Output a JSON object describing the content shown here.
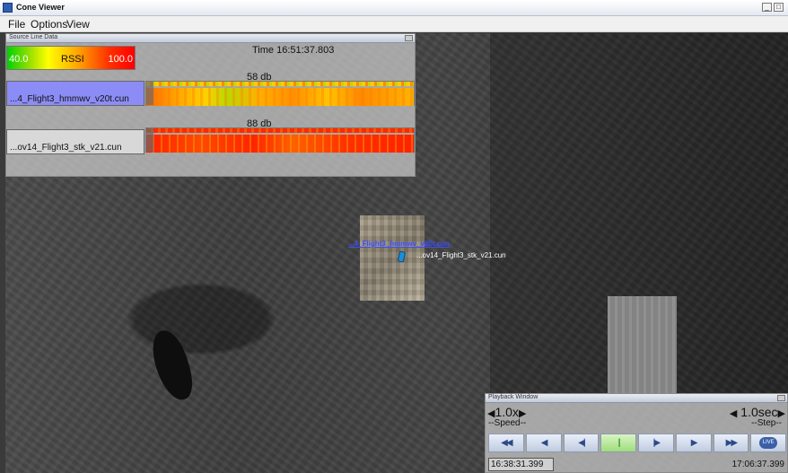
{
  "window": {
    "title": "Cone Viewer",
    "min": "_",
    "max": "□"
  },
  "menu": [
    "File",
    "Options",
    "View"
  ],
  "source_panel": {
    "title": "Source Line Data",
    "legend": {
      "min": "40.0",
      "label": "RSSI",
      "max": "100.0"
    },
    "time": "Time 16:51:37.803",
    "tracks": [
      {
        "name": "...4_Flight3_hmmwv_v20t.cun",
        "db": "58 db"
      },
      {
        "name": "...ov14_Flight3_stk_v21.cun",
        "db": "88 db"
      }
    ]
  },
  "map": {
    "labels": {
      "track1": "...4_Flight3_hmmwv_v20t.cun",
      "track2": "...ov14_Flight3_stk_v21.cun"
    }
  },
  "playback": {
    "title": "Playback Window",
    "speed": {
      "value": "1.0x",
      "label": "--Speed--"
    },
    "step": {
      "value": "1.0sec",
      "label": "--Step--"
    },
    "buttons": [
      {
        "name": "rewind-fast",
        "glyph": "◀◀"
      },
      {
        "name": "rewind",
        "glyph": "◀"
      },
      {
        "name": "step-back",
        "glyph": "◀|"
      },
      {
        "name": "pause",
        "glyph": "||"
      },
      {
        "name": "step-forward",
        "glyph": "|▶"
      },
      {
        "name": "play",
        "glyph": "▶"
      },
      {
        "name": "fast-forward",
        "glyph": "▶▶"
      }
    ],
    "live_label": "LIVE",
    "start_time": "16:38:31.399",
    "end_time": "17:06:37.399"
  }
}
